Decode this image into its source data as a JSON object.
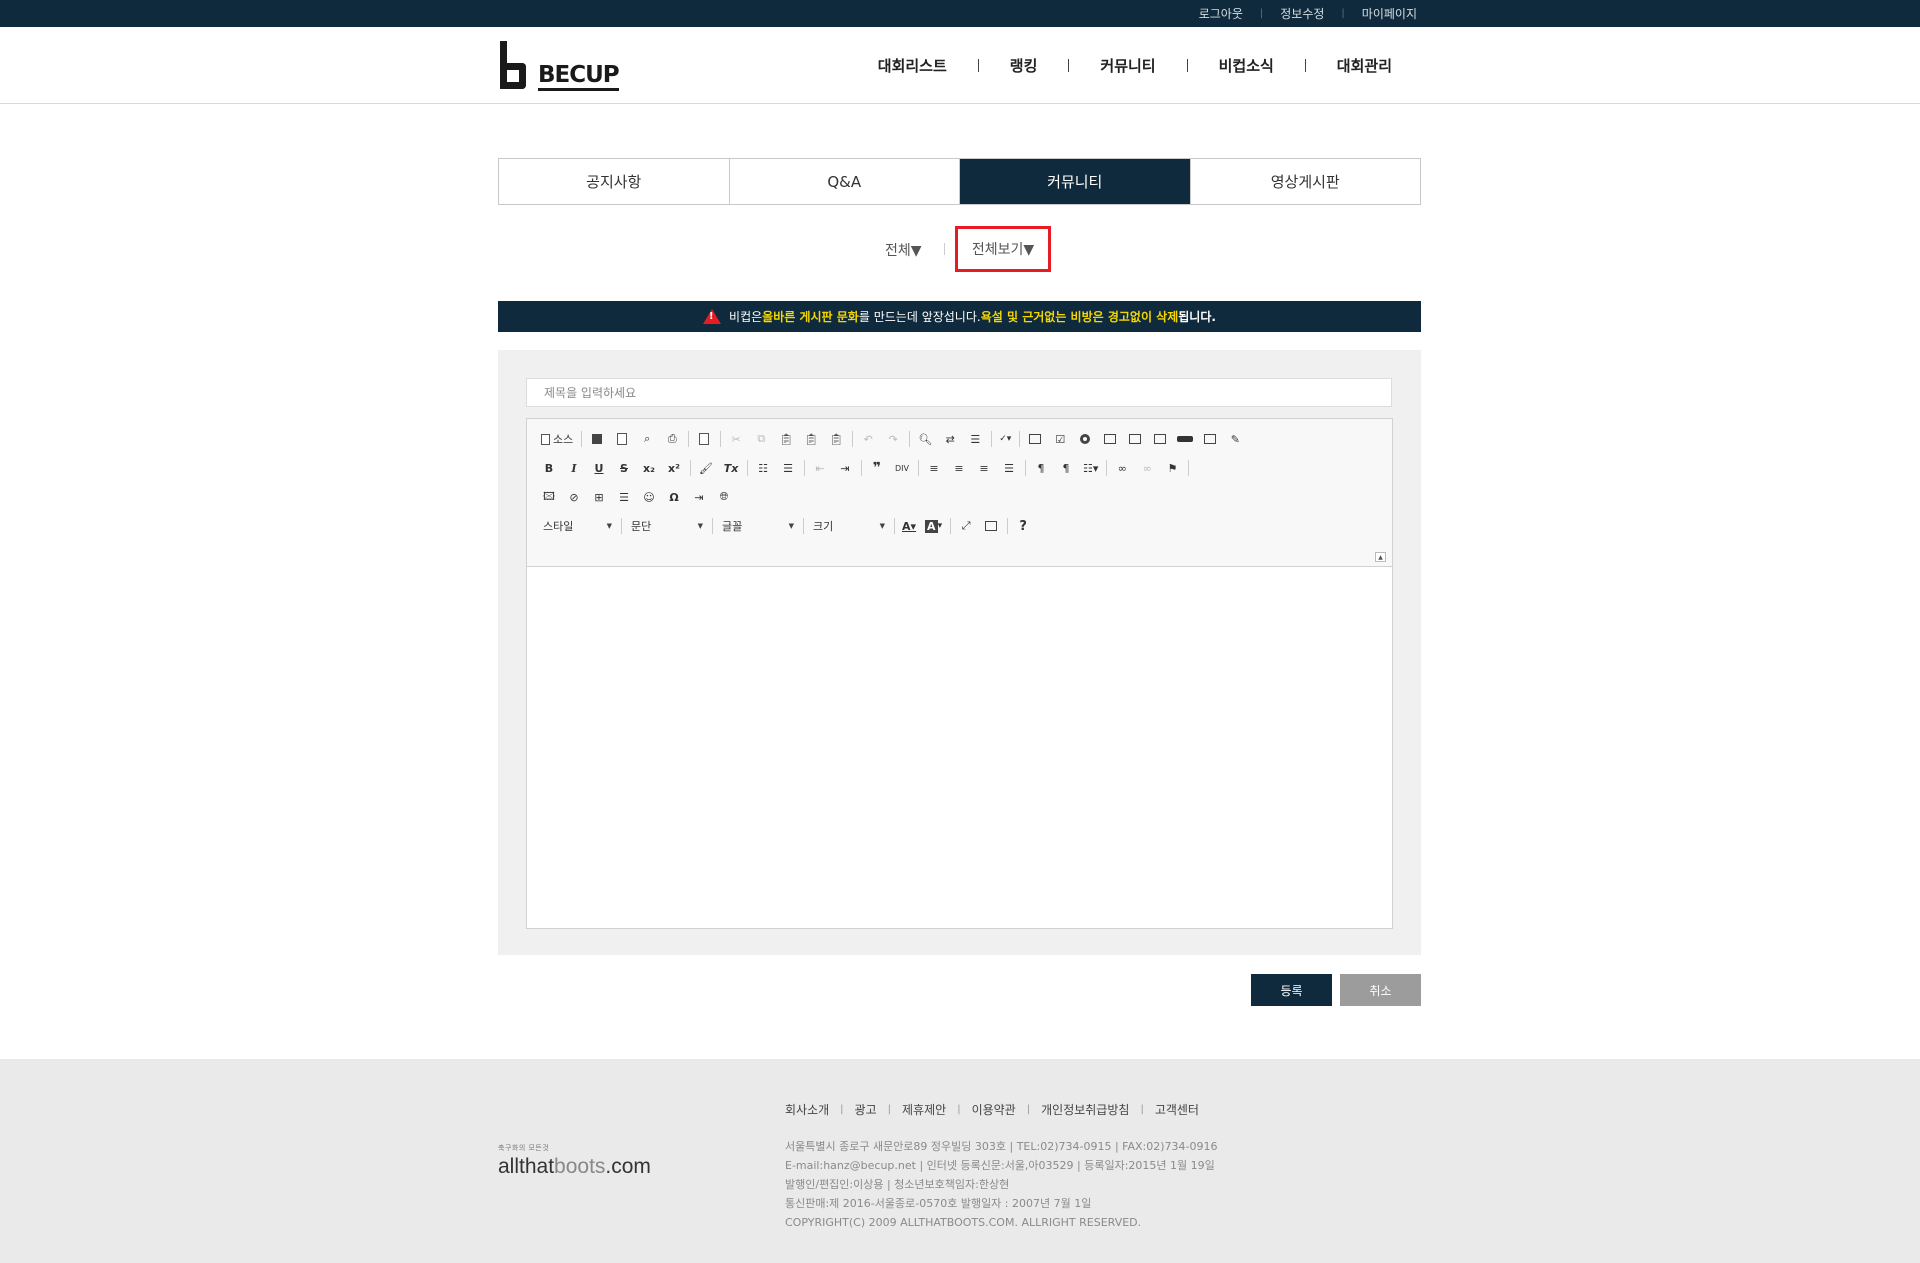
{
  "topbar": {
    "links": [
      "로그아웃",
      "정보수정",
      "마이페이지"
    ]
  },
  "header": {
    "logo_text": "BECUP",
    "nav": [
      "대회리스트",
      "랭킹",
      "커뮤니티",
      "비컵소식",
      "대회관리"
    ]
  },
  "tabs": {
    "items": [
      "공지사항",
      "Q&A",
      "커뮤니티",
      "영상게시판"
    ],
    "active": "커뮤니티"
  },
  "filters": {
    "category": "전체▼",
    "view": "전체보기▼"
  },
  "notice": {
    "part1": "비컵은 ",
    "part2": "올바른 게시판 문화",
    "part3": "를 만드는데 앞장섭니다. ",
    "part4": "욕설 및 근거없는 비방은 경고없이 삭제",
    "part5": "됩니다.",
    "highlight_color": "#f5d700",
    "warning_color": "#e51c23"
  },
  "editor": {
    "title_placeholder": "제목을 입력하세요",
    "source_label": "소스",
    "combos": {
      "style": "스타일",
      "paragraph": "문단",
      "font": "글꼴",
      "size": "크기"
    }
  },
  "buttons": {
    "submit": "등록",
    "cancel": "취소"
  },
  "footer": {
    "logo_small": "축구화의 모든것",
    "logo_main_a": "allthat",
    "logo_main_b": "boots",
    "logo_main_c": ".com",
    "menu": [
      "회사소개",
      "광고",
      "제휴제안",
      "이용약관",
      "개인정보취급방침",
      "고객센터"
    ],
    "info": [
      "서울특별시 종로구 새문안로89 정우빌딩 303호 | TEL:02)734-0915 | FAX:02)734-0916",
      "E-mail:hanz@becup.net | 인터넷 등록신문:서울,아03529 | 등록일자:2015년 1월 19일",
      "발행인/편집인:이상용 | 청소년보호책임자:한상현",
      "통신판매:제 2016-서울종로-0570호 발행일자 : 2007년 7월 1일",
      "COPYRIGHT(C) 2009 ALLTHATBOOTS.COM. ALLRIGHT RESERVED."
    ]
  },
  "colors": {
    "brand_navy": "#0e2a3c",
    "cancel_gray": "#9c9c9c"
  }
}
